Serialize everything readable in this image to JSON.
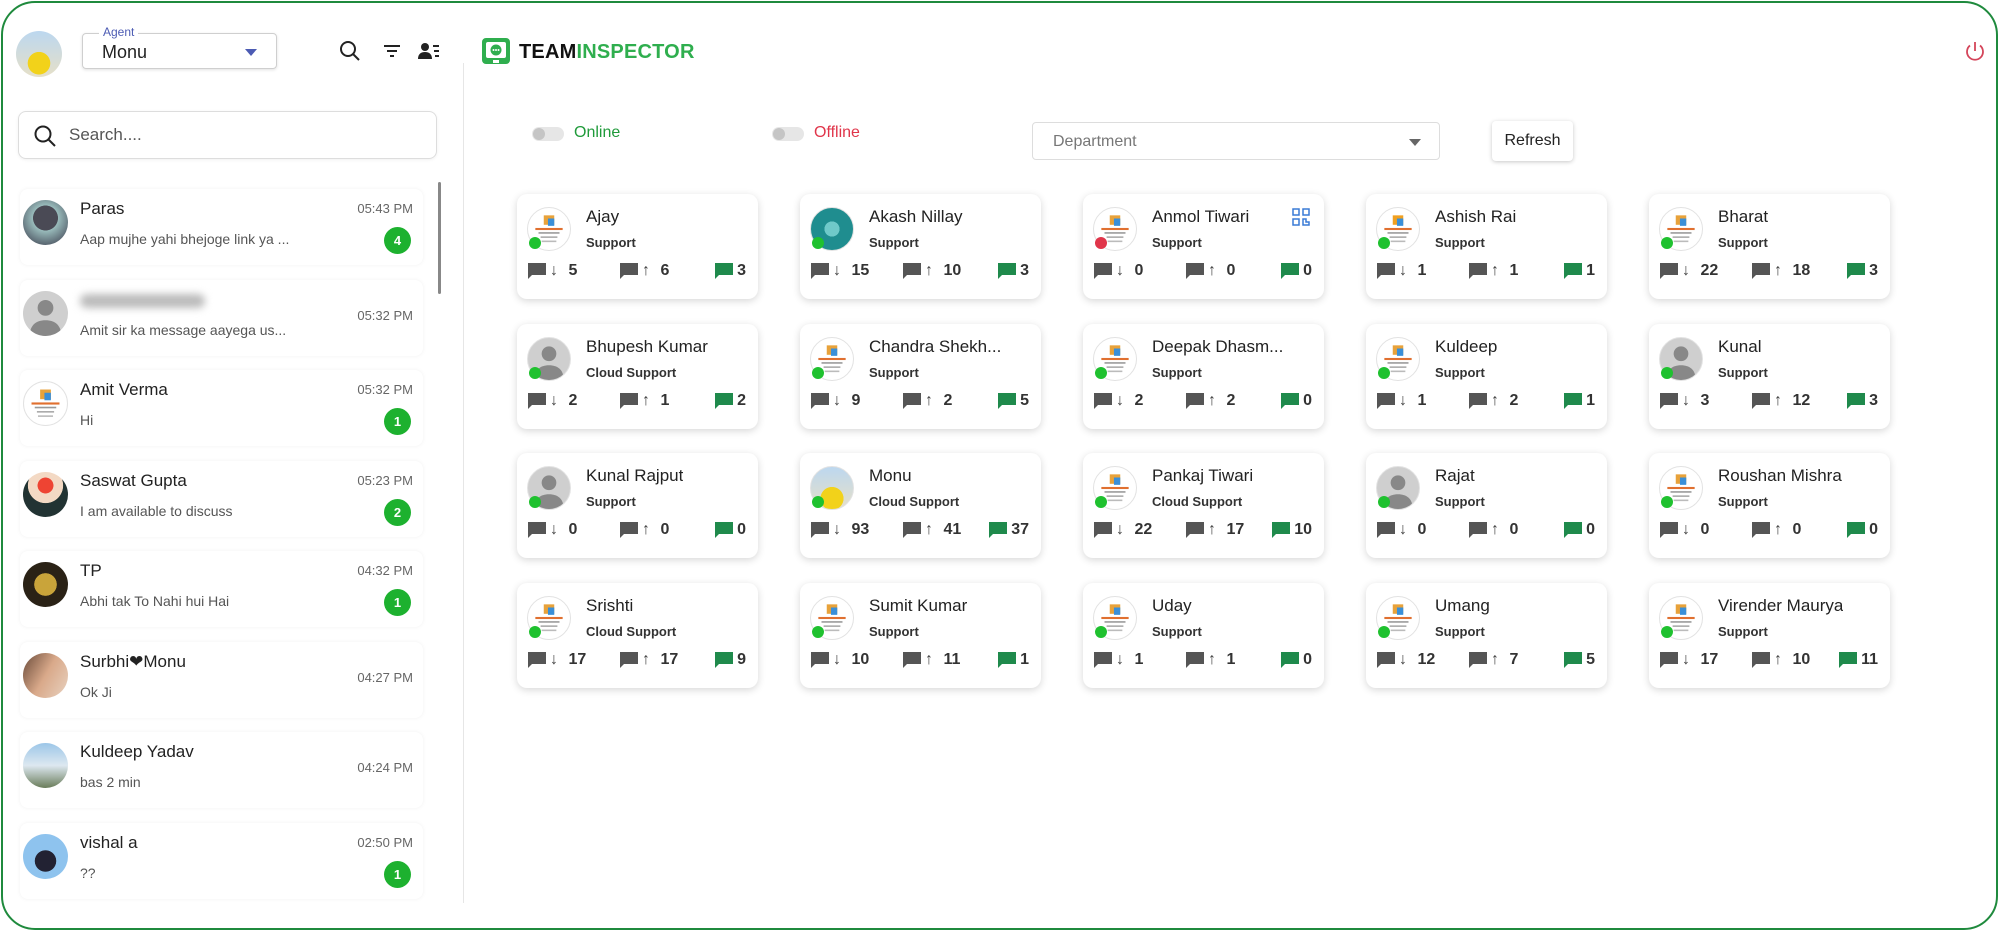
{
  "header": {
    "agent_label": "Agent",
    "agent_value": "Monu",
    "search_placeholder": "Search....",
    "brand_part1": "TEAM",
    "brand_part2": "INSPECTOR"
  },
  "colors": {
    "brand": "#2fae4e",
    "online": "#1fc12f",
    "offline": "#e0354a",
    "badge": "#1db12f"
  },
  "filters": {
    "online_label": "Online",
    "offline_label": "Offline",
    "department_placeholder": "Department",
    "refresh_label": "Refresh"
  },
  "chats": [
    {
      "name": "Paras",
      "message": "Aap mujhe yahi bhejoge link ya ...",
      "time": "05:43 PM",
      "unread": "4",
      "avatar": "photo-dark"
    },
    {
      "name": "",
      "message": "Amit sir ka message aayega us...",
      "time": "05:32 PM",
      "unread": "",
      "avatar": "default",
      "blurred": true
    },
    {
      "name": "Amit Verma",
      "message": "Hi",
      "time": "05:32 PM",
      "unread": "1",
      "avatar": "logo"
    },
    {
      "name": "Saswat Gupta",
      "message": "I am available to discuss",
      "time": "05:23 PM",
      "unread": "2",
      "avatar": "photo-red"
    },
    {
      "name": "TP",
      "message": "Abhi tak To Nahi hui Hai",
      "time": "04:32 PM",
      "unread": "1",
      "avatar": "photo-gold"
    },
    {
      "name": "Surbhi❤Monu",
      "message": "Ok Ji",
      "time": "04:27 PM",
      "unread": "",
      "avatar": "photo-skin"
    },
    {
      "name": "Kuldeep Yadav",
      "message": "bas 2 min",
      "time": "04:24 PM",
      "unread": "",
      "avatar": "photo-sky"
    },
    {
      "name": "vishal a",
      "message": "??",
      "time": "02:50 PM",
      "unread": "1",
      "avatar": "photo-blue"
    }
  ],
  "agents": [
    {
      "name": "Ajay",
      "dept": "Support",
      "status": "online",
      "in": "5",
      "out": "6",
      "chats": "3",
      "avatar": "logo"
    },
    {
      "name": "Akash Nillay",
      "dept": "Support",
      "status": "online",
      "in": "15",
      "out": "10",
      "chats": "3",
      "avatar": "teal"
    },
    {
      "name": "Anmol Tiwari",
      "dept": "Support",
      "status": "offline",
      "in": "0",
      "out": "0",
      "chats": "0",
      "avatar": "logo2",
      "qr": true
    },
    {
      "name": "Ashish Rai",
      "dept": "Support",
      "status": "online",
      "in": "1",
      "out": "1",
      "chats": "1",
      "avatar": "logo3"
    },
    {
      "name": "Bharat",
      "dept": "Support",
      "status": "online",
      "in": "22",
      "out": "18",
      "chats": "3",
      "avatar": "logo"
    },
    {
      "name": "Bhupesh Kumar",
      "dept": "Cloud Support",
      "status": "online",
      "in": "2",
      "out": "1",
      "chats": "2",
      "avatar": "default"
    },
    {
      "name": "Chandra Shekh...",
      "dept": "Support",
      "status": "online",
      "in": "9",
      "out": "2",
      "chats": "5",
      "avatar": "logo2"
    },
    {
      "name": "Deepak Dhasm...",
      "dept": "Support",
      "status": "online",
      "in": "2",
      "out": "2",
      "chats": "0",
      "avatar": "logo"
    },
    {
      "name": "Kuldeep",
      "dept": "Support",
      "status": "online",
      "in": "1",
      "out": "2",
      "chats": "1",
      "avatar": "logo"
    },
    {
      "name": "Kunal",
      "dept": "Support",
      "status": "online",
      "in": "3",
      "out": "12",
      "chats": "3",
      "avatar": "default"
    },
    {
      "name": "Kunal Rajput",
      "dept": "Support",
      "status": "online",
      "in": "0",
      "out": "0",
      "chats": "0",
      "avatar": "default"
    },
    {
      "name": "Monu",
      "dept": "Cloud Support",
      "status": "online",
      "in": "93",
      "out": "41",
      "chats": "37",
      "avatar": "yellow"
    },
    {
      "name": "Pankaj Tiwari",
      "dept": "Cloud Support",
      "status": "online",
      "in": "22",
      "out": "17",
      "chats": "10",
      "avatar": "logo2"
    },
    {
      "name": "Rajat",
      "dept": "Support",
      "status": "online",
      "in": "0",
      "out": "0",
      "chats": "0",
      "avatar": "default"
    },
    {
      "name": "Roushan Mishra",
      "dept": "Support",
      "status": "online",
      "in": "0",
      "out": "0",
      "chats": "0",
      "avatar": "logo"
    },
    {
      "name": "Srishti",
      "dept": "Cloud Support",
      "status": "online",
      "in": "17",
      "out": "17",
      "chats": "9",
      "avatar": "logo"
    },
    {
      "name": "Sumit Kumar",
      "dept": "Support",
      "status": "online",
      "in": "10",
      "out": "11",
      "chats": "1",
      "avatar": "logo2"
    },
    {
      "name": "Uday",
      "dept": "Support",
      "status": "online",
      "in": "1",
      "out": "1",
      "chats": "0",
      "avatar": "logo2"
    },
    {
      "name": "Umang",
      "dept": "Support",
      "status": "online",
      "in": "12",
      "out": "7",
      "chats": "5",
      "avatar": "logo2"
    },
    {
      "name": "Virender Maurya",
      "dept": "Support",
      "status": "online",
      "in": "17",
      "out": "10",
      "chats": "11",
      "avatar": "logo"
    }
  ]
}
